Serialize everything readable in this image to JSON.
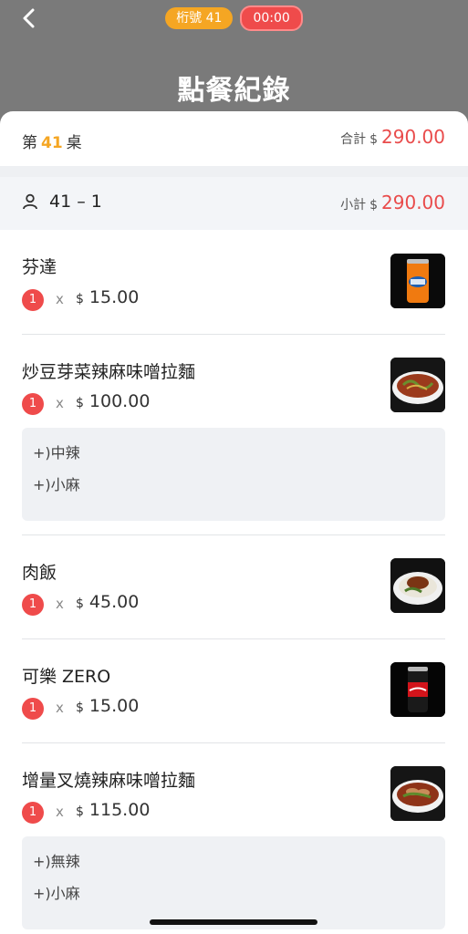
{
  "header": {
    "seat_badge": "桁號 41",
    "timer": "00:00",
    "title": "點餐紀錄"
  },
  "table": {
    "prefix": "第",
    "number": "41",
    "suffix": "桌",
    "total_label": "合計",
    "currency": "$",
    "total": "290.00"
  },
  "seat": {
    "label": "41 – 1",
    "subtotal_label": "小計",
    "currency": "$",
    "subtotal": "290.00"
  },
  "items": [
    {
      "name": "芬達",
      "qty": "1",
      "x": "x",
      "currency": "$",
      "price": "15.00",
      "image": "fanta-can",
      "options": []
    },
    {
      "name": "炒豆芽菜辣麻味噌拉麵",
      "qty": "1",
      "x": "x",
      "currency": "$",
      "price": "100.00",
      "image": "ramen-bowl",
      "options": [
        "+)中辣",
        "+)小麻"
      ]
    },
    {
      "name": "肉飯",
      "qty": "1",
      "x": "x",
      "currency": "$",
      "price": "45.00",
      "image": "pork-rice-bowl",
      "options": []
    },
    {
      "name": "可樂 ZERO",
      "qty": "1",
      "x": "x",
      "currency": "$",
      "price": "15.00",
      "image": "coke-can",
      "options": []
    },
    {
      "name": "增量叉燒辣麻味噌拉麵",
      "qty": "1",
      "x": "x",
      "currency": "$",
      "price": "115.00",
      "image": "chashu-ramen-bowl",
      "options": [
        "+)無辣",
        "+)小麻"
      ]
    }
  ],
  "colors": {
    "header_bg": "#7a7a7a",
    "accent_orange": "#f5a623",
    "accent_red": "#ef4b4b"
  }
}
